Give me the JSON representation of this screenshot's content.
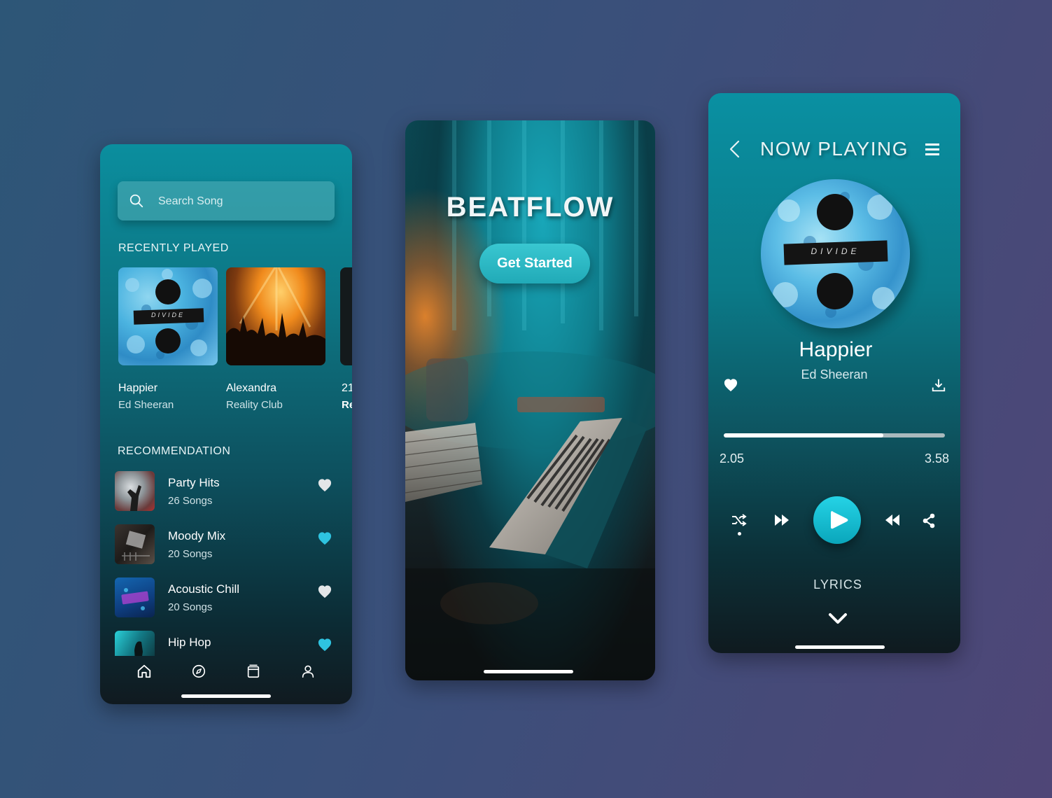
{
  "home": {
    "search": {
      "placeholder": "Search Song"
    },
    "recently_played": {
      "title": "RECENTLY PLAYED",
      "items": [
        {
          "title": "Happier",
          "artist": "Ed Sheeran",
          "cover": "divide-cover"
        },
        {
          "title": "Alexandra",
          "artist": "Reality Club",
          "cover": "concert-photo"
        },
        {
          "title": "21",
          "artist": "Re",
          "cover": "dark-cover"
        }
      ]
    },
    "recommendation": {
      "title": "RECOMMENDATION",
      "items": [
        {
          "title": "Party Hits",
          "count": "26 Songs",
          "liked": false
        },
        {
          "title": "Moody Mix",
          "count": "20 Songs",
          "liked": true
        },
        {
          "title": "Acoustic Chill",
          "count": "20 Songs",
          "liked": false
        },
        {
          "title": "Hip Hop",
          "count": "",
          "liked": true
        }
      ]
    },
    "nav": [
      "home-icon",
      "compass-icon",
      "library-icon",
      "profile-icon"
    ]
  },
  "splash": {
    "brand": "BEATFLOW",
    "cta_label": "Get Started"
  },
  "player": {
    "title": "NOW PLAYING",
    "song": "Happier",
    "artist": "Ed Sheeran",
    "elapsed": "2.05",
    "duration": "3.58",
    "progress": 0.72,
    "lyrics_label": "LYRICS",
    "album_text": "DIVIDE"
  },
  "colors": {
    "accent": "#21c4d6",
    "heart_liked": "#2ec3e0",
    "heart_default": "#e3e6e8"
  }
}
